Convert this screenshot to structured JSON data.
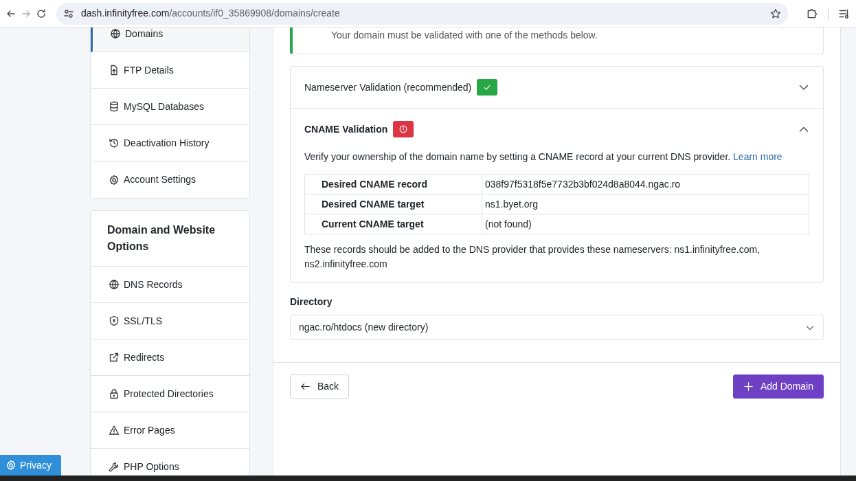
{
  "browser": {
    "url_host": "dash.infinityfree.com",
    "url_path": "/accounts/if0_35869908/domains/create"
  },
  "sidebar": [
    {
      "items": [
        {
          "label": "Domains",
          "selected": true
        },
        {
          "label": "FTP Details",
          "selected": false
        },
        {
          "label": "MySQL Databases",
          "selected": false
        },
        {
          "label": "Deactivation History",
          "selected": false
        },
        {
          "label": "Account Settings",
          "selected": false
        }
      ]
    },
    {
      "title": "Domain and Website Options",
      "items": [
        {
          "label": "DNS Records",
          "selected": false
        },
        {
          "label": "SSL/TLS",
          "selected": false
        },
        {
          "label": "Redirects",
          "selected": false
        },
        {
          "label": "Protected Directories",
          "selected": false
        },
        {
          "label": "Error Pages",
          "selected": false
        },
        {
          "label": "PHP Options",
          "selected": false
        }
      ]
    }
  ],
  "alert": {
    "text": "Your domain must be validated with one of the methods below."
  },
  "validations": [
    {
      "title": "Nameserver Validation (recommended)",
      "kind": "ok",
      "expanded": false
    },
    {
      "title": "CNAME Validation",
      "kind": "error",
      "expanded": true,
      "description": "Verify your ownership of the domain name by setting a CNAME record at your current DNS provider.",
      "link": "Learn more",
      "records": [
        {
          "label": "Desired CNAME record",
          "value": "038f97f5318f5e7732b3bf024d8a8044.ngac.ro"
        },
        {
          "label": "Desired CNAME target",
          "value": "ns1.byet.org"
        },
        {
          "label": "Current CNAME target",
          "value": "(not found)"
        }
      ],
      "note": "These records should be added to the DNS provider that provides these nameservers: ns1.infinityfree.com, ns2.infinityfree.com"
    }
  ],
  "directory": {
    "label": "Directory",
    "value": "ngac.ro/htdocs (new directory)"
  },
  "buttons": [
    {
      "label": "Back",
      "kind": "back"
    },
    {
      "label": "Add Domain",
      "kind": "add"
    }
  ],
  "privacy": {
    "label": "Privacy"
  }
}
